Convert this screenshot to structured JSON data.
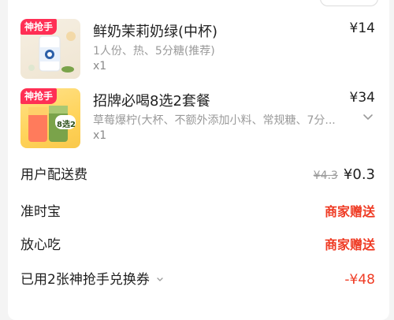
{
  "items": [
    {
      "badge": "神抢手",
      "title": "鲜奶茉莉奶绿(中杯)",
      "price": "¥14",
      "spec": "1人份、热、5分糖(推荐)",
      "qty": "x1"
    },
    {
      "badge": "神抢手",
      "title": "招牌必喝8选2套餐",
      "price": "¥34",
      "spec": "草莓爆柠(大杯、不额外添加小料、常规糖、7分...",
      "qty": "x1",
      "thumb_tag": "8选2"
    }
  ],
  "fees": {
    "delivery_label": "用户配送费",
    "delivery_original": "¥4.3",
    "delivery_price": "¥0.3",
    "ontime_label": "准时宝",
    "ontime_value": "商家赠送",
    "assured_label": "放心吃",
    "assured_value": "商家赠送",
    "voucher_label": "已用2张神抢手兑换券",
    "voucher_value": "-¥48"
  },
  "colors": {
    "badge": "#ff2f55",
    "accent_red": "#ef3b24"
  }
}
